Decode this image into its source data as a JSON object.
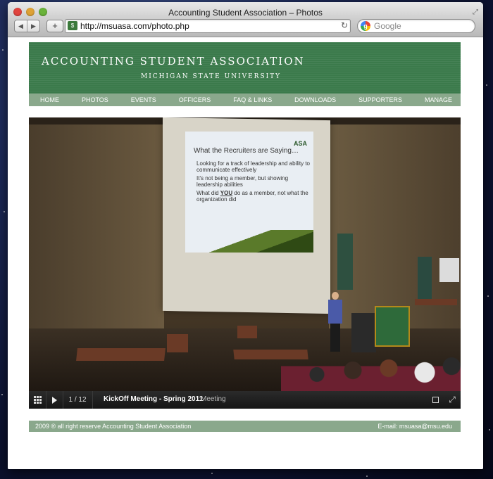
{
  "window": {
    "title": "Accounting Student Association – Photos",
    "url": "http://msuasa.com/photo.php",
    "search_placeholder": "Google"
  },
  "banner": {
    "title": "ACCOUNTING STUDENT ASSOCIATION",
    "subtitle": "MICHIGAN STATE UNIVERSITY"
  },
  "nav": {
    "items": [
      {
        "label": "HOME"
      },
      {
        "label": "PHOTOS"
      },
      {
        "label": "EVENTS"
      },
      {
        "label": "OFFICERS"
      },
      {
        "label": "FAQ & LINKS"
      },
      {
        "label": "DOWNLOADS"
      },
      {
        "label": "SUPPORTERS"
      },
      {
        "label": "MANAGE"
      }
    ]
  },
  "slide": {
    "logo": "ASA",
    "heading": "What the Recruiters are Saying…",
    "bullet1": "Looking for a track of leadership and ability to communicate effectively",
    "bullet2": "It's not being a member, but showing leadership abilities",
    "bullet3_pre": "What did ",
    "bullet3_em": "YOU",
    "bullet3_post": " do as a member, not what the organization did"
  },
  "viewer": {
    "counter": "1 / 12",
    "photo_title": "KickOff Meeting - Spring 2011",
    "category": "Meeting"
  },
  "footer": {
    "copyright": "2009 ® all right reserve Accounting Student Association",
    "email": "E-mail: msuasa@msu.edu"
  },
  "colors": {
    "banner_green": "#3b7a4b",
    "nav_green": "#8aa88c"
  }
}
